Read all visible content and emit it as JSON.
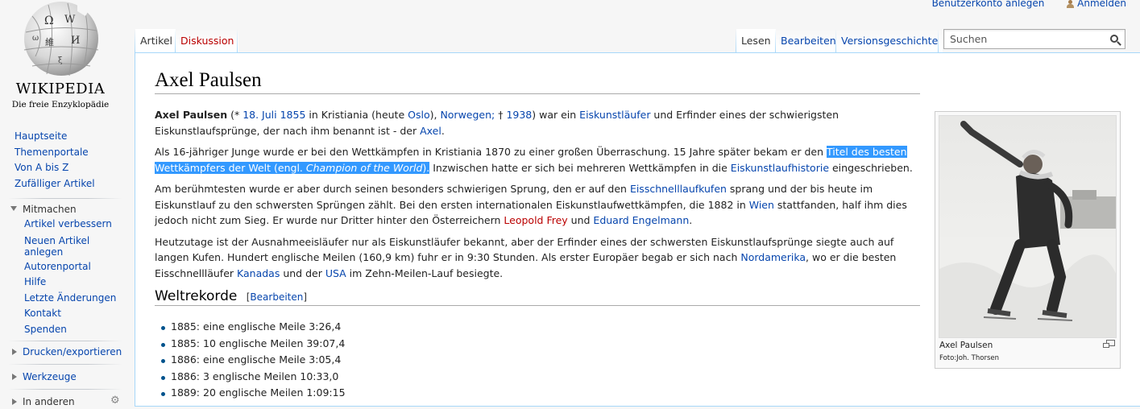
{
  "personal_tools": {
    "create_account": "Benutzerkonto anlegen",
    "login": "Anmelden"
  },
  "logo": {
    "wordmark": "WIKIPEDIA",
    "tagline": "Die freie Enzyklopädie"
  },
  "nav": [
    "Hauptseite",
    "Themenportale",
    "Von A bis Z",
    "Zufälliger Artikel"
  ],
  "mitmachen": {
    "label": "Mitmachen",
    "items": [
      "Artikel verbessern",
      "Neuen Artikel anlegen",
      "Autorenportal",
      "Hilfe",
      "Letzte Änderungen",
      "Kontakt",
      "Spenden"
    ]
  },
  "portals": {
    "print": "Drucken/exportieren",
    "tools": "Werkzeuge",
    "lang": "In anderen"
  },
  "tabs": {
    "article": "Artikel",
    "discussion": "Diskussion",
    "read": "Lesen",
    "edit": "Bearbeiten",
    "history": "Versionsgeschichte"
  },
  "search": {
    "placeholder": "Suchen"
  },
  "article": {
    "title": "Axel Paulsen",
    "p1": {
      "name": "Axel Paulsen",
      "t1": " (* ",
      "birth_date": "18. Juli",
      "birth_year": "1855",
      "t2": " in Kristiania (heute ",
      "oslo": "Oslo",
      "t3": "), ",
      "norway": "Norwegen;",
      "t4": " † ",
      "death_year": "1938",
      "t5": ") war ein ",
      "skater": "Eiskunstläufer",
      "t6": " und Erfinder eines der schwierigsten Eiskunstlaufsprünge, der nach ihm benannt ist - der ",
      "axel": "Axel",
      "t7": "."
    },
    "p2": {
      "t1": "Als 16-jähriger Junge wurde er bei den Wettkämpfen in Kristiania 1870 zu einer großen Überraschung. 15 Jahre später bekam er den ",
      "sel1": "Titel des besten Wettkämpfers der Welt (engl. ",
      "sel_em": "Champion of the World",
      "sel2": ").",
      "t2": " Inzwischen hatte er sich bei mehreren Wettkämpfen in die ",
      "history": "Eiskunstlaufhistorie",
      "t3": " eingeschrieben."
    },
    "p3": {
      "t1": "Am berühmtesten wurde er aber durch seinen besonders schwierigen Sprung, den er auf den ",
      "kufen": "Eisschnelllaufkufen",
      "t2": " sprang und der bis heute im Eiskunstlauf zu den schwersten Sprüngen zählt. Bei den ersten internationalen Eiskunstlaufwettkämpfen, die 1882 in ",
      "wien": "Wien",
      "t3": " stattfanden, half ihm dies jedoch nicht zum Sieg. Er wurde nur Dritter hinter den Österreichern ",
      "frey": "Leopold Frey",
      "t4": " und ",
      "engelmann": "Eduard Engelmann",
      "t5": "."
    },
    "p4": {
      "t1": "Heutzutage ist der Ausnahmeeisläufer nur als Eiskunstläufer bekannt, aber der Erfinder eines der schwersten Eiskunstlaufsprünge siegte auch auf langen Kufen. Hundert englische Meilen (160,9 km) fuhr er in 9:30 Stunden. Als erster Europäer begab er sich nach ",
      "nordamerika": "Nordamerika",
      "t2": ", wo er die besten Eisschnellläufer ",
      "kanadas": "Kanadas",
      "t3": " und der ",
      "usa": "USA",
      "t4": " im Zehn-Meilen-Lauf besiegte."
    },
    "section": {
      "title": "Weltrekorde",
      "edit": "Bearbeiten"
    },
    "records": [
      "1885: eine englische Meile 3:26,4",
      "1885: 10 englische Meilen 39:07,4",
      "1886: eine englische Meile 3:05,4",
      "1886: 3 englische Meilen 10:33,0",
      "1889: 20 englische Meilen 1:09:15"
    ],
    "thumb": {
      "caption": "Axel Paulsen",
      "credit": "Foto:Joh. Thorsen"
    }
  }
}
